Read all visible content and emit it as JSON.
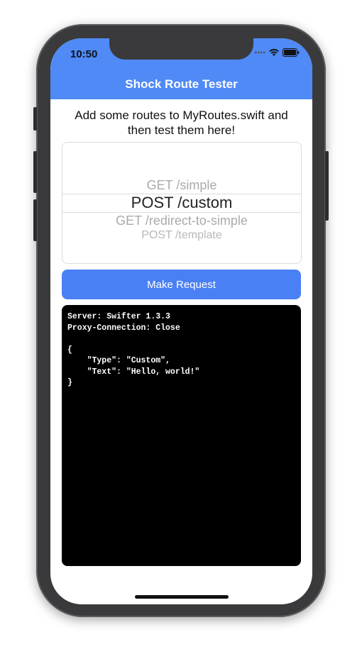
{
  "status_bar": {
    "time": "10:50"
  },
  "nav": {
    "title": "Shock Route Tester"
  },
  "instructions": "Add some routes to MyRoutes.swift and then test them here!",
  "picker": {
    "items": [
      "GET /simple",
      "POST /custom",
      "GET /redirect-to-simple",
      "POST /template"
    ],
    "selected": "POST /custom"
  },
  "button": {
    "label": "Make Request"
  },
  "console": {
    "text": "Server: Swifter 1.3.3\nProxy-Connection: Close\n\n{\n    \"Type\": \"Custom\",\n    \"Text\": \"Hello, world!\"\n}"
  },
  "colors": {
    "accent": "#4f8af6",
    "button": "#4a80f5",
    "console_bg": "#000000"
  }
}
